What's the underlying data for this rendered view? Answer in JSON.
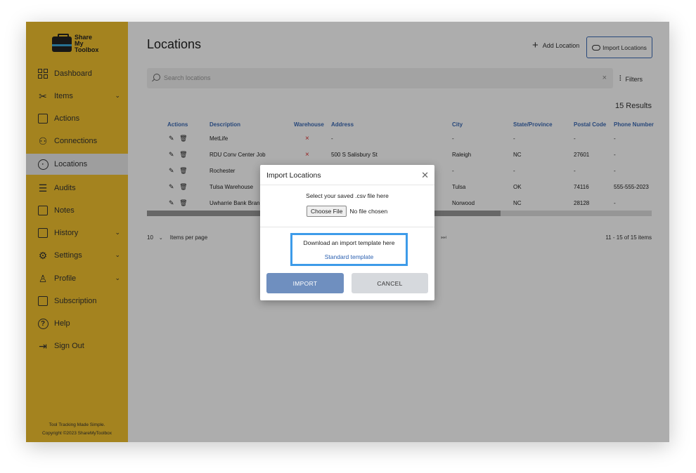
{
  "brand": {
    "line1": "Share",
    "line2": "My",
    "line3": "Toolbox"
  },
  "sidebar": {
    "items": [
      {
        "label": "Dashboard"
      },
      {
        "label": "Items"
      },
      {
        "label": "Actions"
      },
      {
        "label": "Connections"
      },
      {
        "label": "Locations"
      },
      {
        "label": "Audits"
      },
      {
        "label": "Notes"
      },
      {
        "label": "History"
      },
      {
        "label": "Settings"
      },
      {
        "label": "Profile"
      },
      {
        "label": "Subscription"
      },
      {
        "label": "Help"
      },
      {
        "label": "Sign Out"
      }
    ],
    "active": "Locations",
    "footer_tagline": "Tool Tracking Made Simple.",
    "footer_copyright": "Copyright ©2023 ShareMyToolbox"
  },
  "header": {
    "title": "Locations",
    "add_label": "Add Location",
    "import_label": "Import Locations"
  },
  "search": {
    "placeholder": "Search locations",
    "clear": "×"
  },
  "filters_label": "Filters",
  "results_label": "15 Results",
  "table": {
    "columns": [
      "Actions",
      "Description",
      "Warehouse",
      "Address",
      "City",
      "State/Province",
      "Postal Code",
      "Phone Number"
    ],
    "rows": [
      {
        "description": "MetLife",
        "warehouse": "×",
        "address": "-",
        "city": "-",
        "state": "-",
        "postal": "-",
        "phone": "-"
      },
      {
        "description": "RDU Conv Center Job",
        "warehouse": "×",
        "address": "500 S Salisbury St",
        "city": "Raleigh",
        "state": "NC",
        "postal": "27601",
        "phone": "-"
      },
      {
        "description": "Rochester",
        "warehouse": "",
        "address": "",
        "city": "-",
        "state": "-",
        "postal": "-",
        "phone": "-"
      },
      {
        "description": "Tulsa Warehouse",
        "warehouse": "",
        "address": "",
        "city": "Tulsa",
        "state": "OK",
        "postal": "74116",
        "phone": "555-555-2023"
      },
      {
        "description": "Uwharrie Bank Bran",
        "warehouse": "",
        "address": "",
        "city": "Norwood",
        "state": "NC",
        "postal": "28128",
        "phone": "-"
      }
    ]
  },
  "pager": {
    "page_size": "10",
    "per_page_label": "Items per page",
    "range": "11 - 15 of 15 items"
  },
  "modal": {
    "title": "Import Locations",
    "hint": "Select your saved .csv file here",
    "choose_file": "Choose File",
    "no_file": "No file chosen",
    "template_label": "Download an import template here",
    "template_link": "Standard template",
    "import_button": "IMPORT",
    "cancel_button": "CANCEL"
  }
}
